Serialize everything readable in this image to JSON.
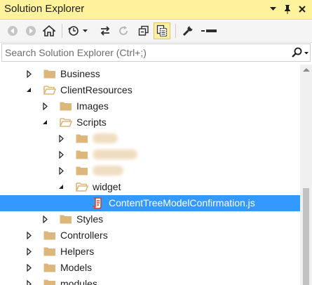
{
  "window": {
    "title": "Solution Explorer",
    "controls": [
      "dropdown-icon",
      "pin-icon",
      "close-icon"
    ],
    "title_bar_color": "#fff29d"
  },
  "toolbar": {
    "buttons": [
      "back-icon",
      "forward-icon",
      "home-icon",
      "pending-changes-filter-icon",
      "sync-with-active-document-icon",
      "refresh-icon",
      "collapse-all-icon",
      "show-all-files-icon",
      "properties-icon",
      "preview-selected-items-icon"
    ],
    "active_button": "show-all-files-icon"
  },
  "search": {
    "placeholder": "Search Solution Explorer (Ctrl+;)"
  },
  "tree": {
    "items": [
      {
        "label": "Business",
        "expanded": false
      },
      {
        "label": "ClientResources",
        "expanded": true
      },
      {
        "label": "Images",
        "expanded": false
      },
      {
        "label": "Scripts",
        "expanded": true
      },
      {
        "label": "",
        "expanded": false,
        "obscured": true
      },
      {
        "label": "",
        "expanded": false,
        "obscured": true
      },
      {
        "label": "",
        "expanded": false,
        "obscured": true
      },
      {
        "label": "widget",
        "expanded": true
      },
      {
        "label": "ContentTreeModelConfirmation.js",
        "type": "file",
        "selected": true
      },
      {
        "label": "Styles",
        "expanded": false
      },
      {
        "label": "Controllers",
        "expanded": false
      },
      {
        "label": "Helpers",
        "expanded": false
      },
      {
        "label": "Models",
        "expanded": false
      },
      {
        "label": "modules",
        "expanded": false
      }
    ],
    "selection_color": "#3399ff",
    "folder_color": "#dcb67a"
  }
}
